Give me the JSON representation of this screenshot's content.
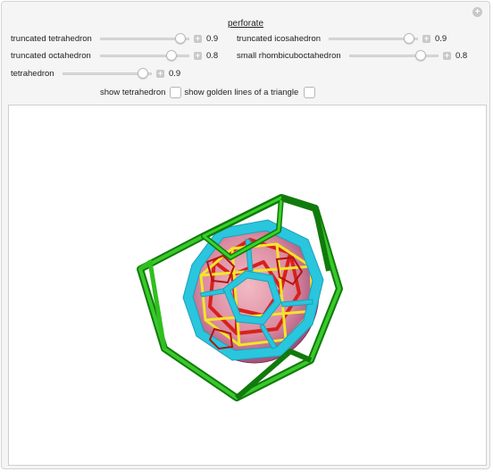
{
  "section_title": "perforate",
  "sliders": {
    "truncated_tetrahedron": {
      "label": "truncated tetrahedron",
      "value": "0.9",
      "fraction": 0.9
    },
    "truncated_icosahedron": {
      "label": "truncated icosahedron",
      "value": "0.9",
      "fraction": 0.9
    },
    "truncated_octahedron": {
      "label": "truncated octahedron",
      "value": "0.8",
      "fraction": 0.8
    },
    "small_rhombicuboctahedron": {
      "label": "small rhombicuboctahedron",
      "value": "0.8",
      "fraction": 0.8
    },
    "tetrahedron": {
      "label": "tetrahedron",
      "value": "0.9",
      "fraction": 0.9
    }
  },
  "checkboxes": {
    "show_tetrahedron": {
      "label": "show tetrahedron",
      "checked": false
    },
    "show_golden_lines": {
      "label": "show golden lines of a triangle",
      "checked": false
    }
  },
  "colors": {
    "frame_green": "#2fbf1f",
    "frame_green_dark": "#117a0c",
    "cyan": "#29c6de",
    "yellow": "#f2e52a",
    "red": "#d8211b",
    "pink": "#e9a3b0",
    "magenta": "#a34b78"
  },
  "icons": {
    "corner": "plus-circle-icon",
    "slider_plus": "plus-box-icon"
  }
}
